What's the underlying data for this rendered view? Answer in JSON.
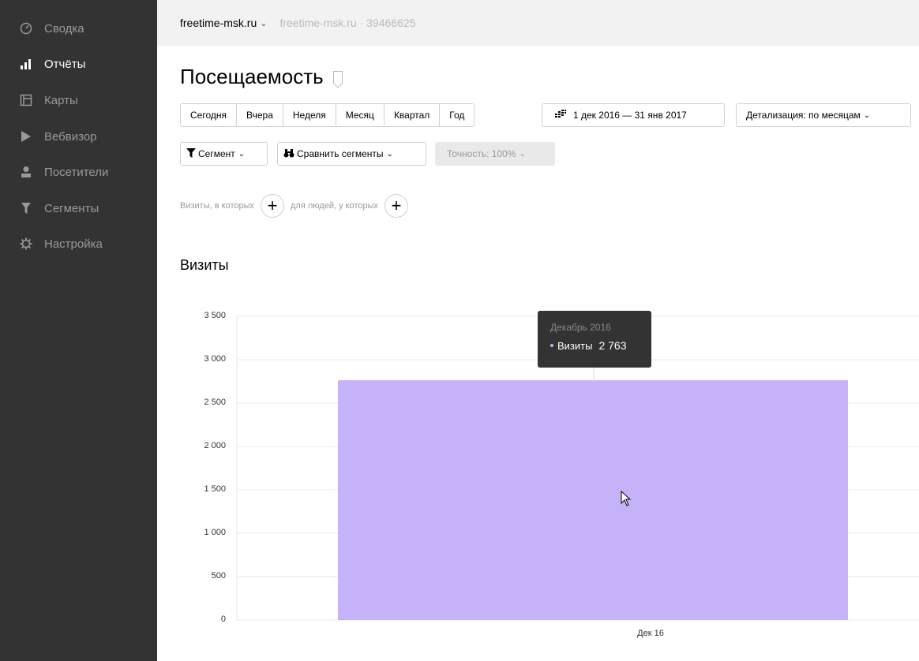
{
  "sidebar": {
    "items": [
      {
        "label": "Сводка",
        "icon": "dashboard-icon",
        "active": false
      },
      {
        "label": "Отчёты",
        "icon": "bar-chart-icon",
        "active": true
      },
      {
        "label": "Карты",
        "icon": "map-icon",
        "active": false
      },
      {
        "label": "Вебвизор",
        "icon": "play-icon",
        "active": false
      },
      {
        "label": "Посетители",
        "icon": "user-icon",
        "active": false
      },
      {
        "label": "Сегменты",
        "icon": "filter-icon",
        "active": false
      },
      {
        "label": "Настройка",
        "icon": "gear-icon",
        "active": false
      }
    ]
  },
  "topbar": {
    "site": "freetime-msk.ru",
    "site_sub": "freetime-msk.ru · 39466625"
  },
  "page": {
    "title": "Посещаемость"
  },
  "periods": [
    "Сегодня",
    "Вчера",
    "Неделя",
    "Месяц",
    "Квартал",
    "Год"
  ],
  "date_range": "1 дек 2016 — 31 янв 2017",
  "detail": "Детализация: по месяцам",
  "segment_label": "Сегмент",
  "compare_label": "Сравнить сегменты",
  "accuracy_label": "Точность: 100%",
  "filters": {
    "visits_label": "Визиты, в которых",
    "people_label": "для людей, у которых"
  },
  "section_title": "Визиты",
  "tooltip": {
    "title": "Декабрь 2016",
    "series": "Визиты",
    "value": "2 763"
  },
  "colors": {
    "sidebar_bg": "#333333",
    "bar": "#c5b2f8",
    "tooltip_bg": "#333333"
  },
  "chart_data": {
    "type": "bar",
    "categories": [
      "Дек 16"
    ],
    "series": [
      {
        "name": "Визиты",
        "values": [
          2763
        ]
      }
    ],
    "title": "",
    "xlabel": "",
    "ylabel": "",
    "ylim": [
      0,
      3500
    ],
    "yticks": [
      "3 500",
      "3 000",
      "2 500",
      "2 000",
      "1 500",
      "1 000",
      "500",
      "0"
    ],
    "grid": true
  }
}
